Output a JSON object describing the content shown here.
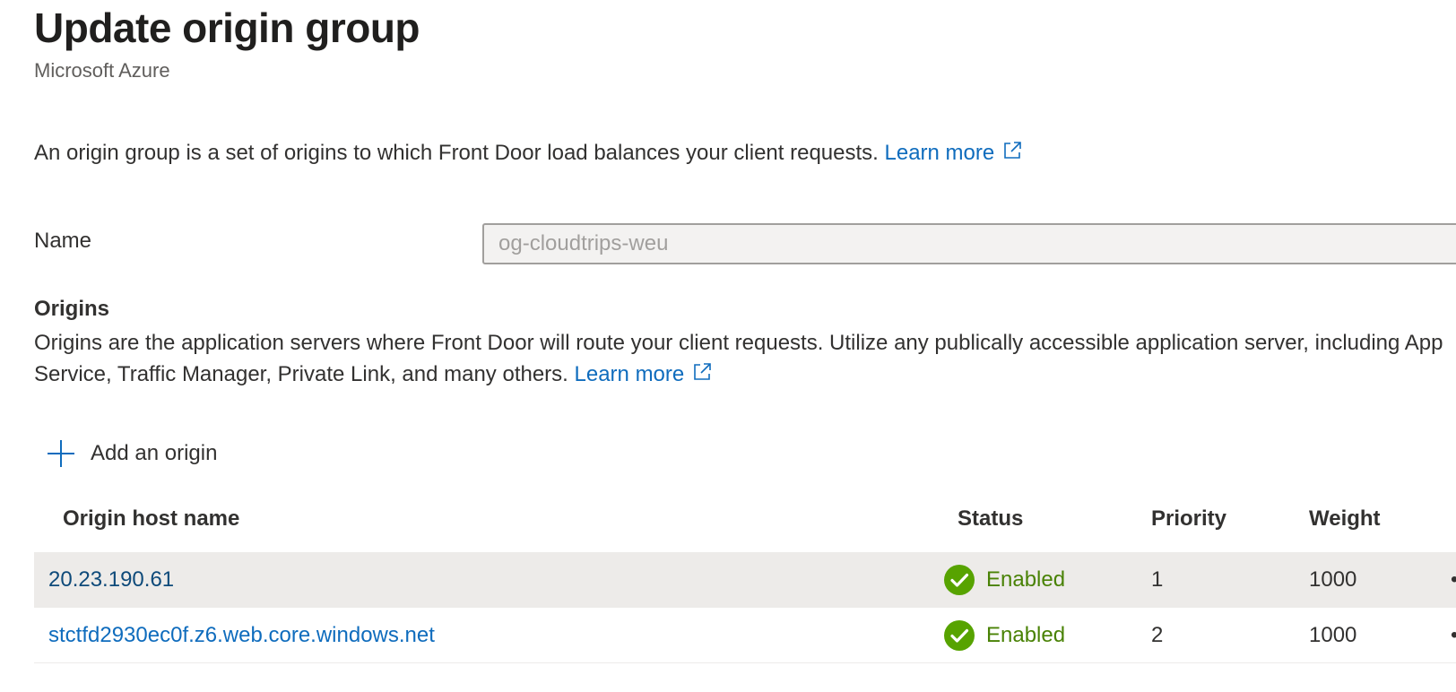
{
  "header": {
    "title": "Update origin group",
    "subtitle": "Microsoft Azure"
  },
  "intro": {
    "text": "An origin group is a set of origins to which Front Door load balances your client requests. ",
    "learn_more": "Learn more"
  },
  "name_field": {
    "label": "Name",
    "value": "og-cloudtrips-weu"
  },
  "origins": {
    "title": "Origins",
    "description": "Origins are the application servers where Front Door will route your client requests. Utilize any publically accessible application server, including App Service, Traffic Manager, Private Link, and many others. ",
    "learn_more": "Learn more",
    "add_label": "Add an origin",
    "columns": {
      "host": "Origin host name",
      "status": "Status",
      "priority": "Priority",
      "weight": "Weight"
    },
    "rows": [
      {
        "host": "20.23.190.61",
        "status": "Enabled",
        "priority": "1",
        "weight": "1000"
      },
      {
        "host": "stctfd2930ec0f.z6.web.core.windows.net",
        "status": "Enabled",
        "priority": "2",
        "weight": "1000"
      }
    ]
  },
  "icons": {
    "external_link": "external-link-icon",
    "add": "plus-icon",
    "status_enabled": "checkmark-circle-icon",
    "more_actions": "more-actions-icon"
  },
  "colors": {
    "link": "#0f6cbd",
    "enabled_green": "#498205",
    "check_fill": "#57a300",
    "selected_row": "#edebe9",
    "input_bg": "#f3f2f1"
  }
}
